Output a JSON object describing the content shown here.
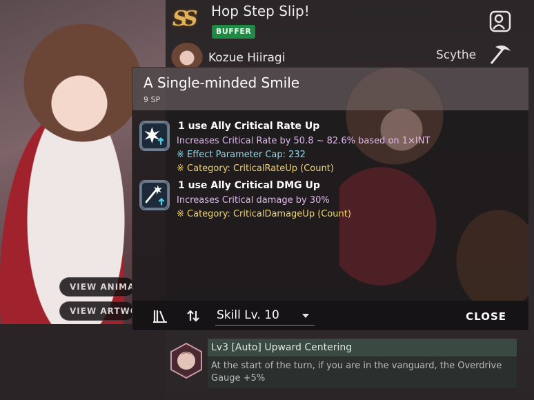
{
  "header": {
    "skill_title": "Hop Step Slip!",
    "badge": "BUFFER",
    "character_name": "Kozue Hiiragi",
    "weapon_type": "Scythe"
  },
  "side_buttons": {
    "view_animation": "VIEW ANIMATI",
    "view_artwork": "VIEW ARTWO"
  },
  "modal": {
    "title": "A Single-minded Smile",
    "sp_cost": "9 SP",
    "effects": [
      {
        "name": "1 use Ally Critical Rate Up",
        "description": "Increases Critical Rate by 50.8 ~ 82.6% based on 1×INT",
        "cap": "※ Effect Parameter Cap: 232",
        "category": "※ Category: CriticalRateUp (Count)",
        "icon": "critical-rate-up-icon"
      },
      {
        "name": "1 use Ally Critical DMG Up",
        "description": "Increases Critical damage by 30%",
        "category": "※ Category: CriticalDamageUp (Count)",
        "icon": "critical-damage-up-icon"
      }
    ],
    "footer": {
      "skill_level": "Skill Lv. 10",
      "close_label": "CLOSE"
    }
  },
  "passive": {
    "title": "Lv3 [Auto] Upward Centering",
    "description": "At the start of the turn, if you are in the vanguard, the Overdrive Gauge +5%"
  },
  "colors": {
    "buffer_badge": "#1e8a44",
    "effect_desc": "#e3b8f0",
    "effect_cap": "#8fd8e8",
    "effect_category": "#f2d56a"
  }
}
